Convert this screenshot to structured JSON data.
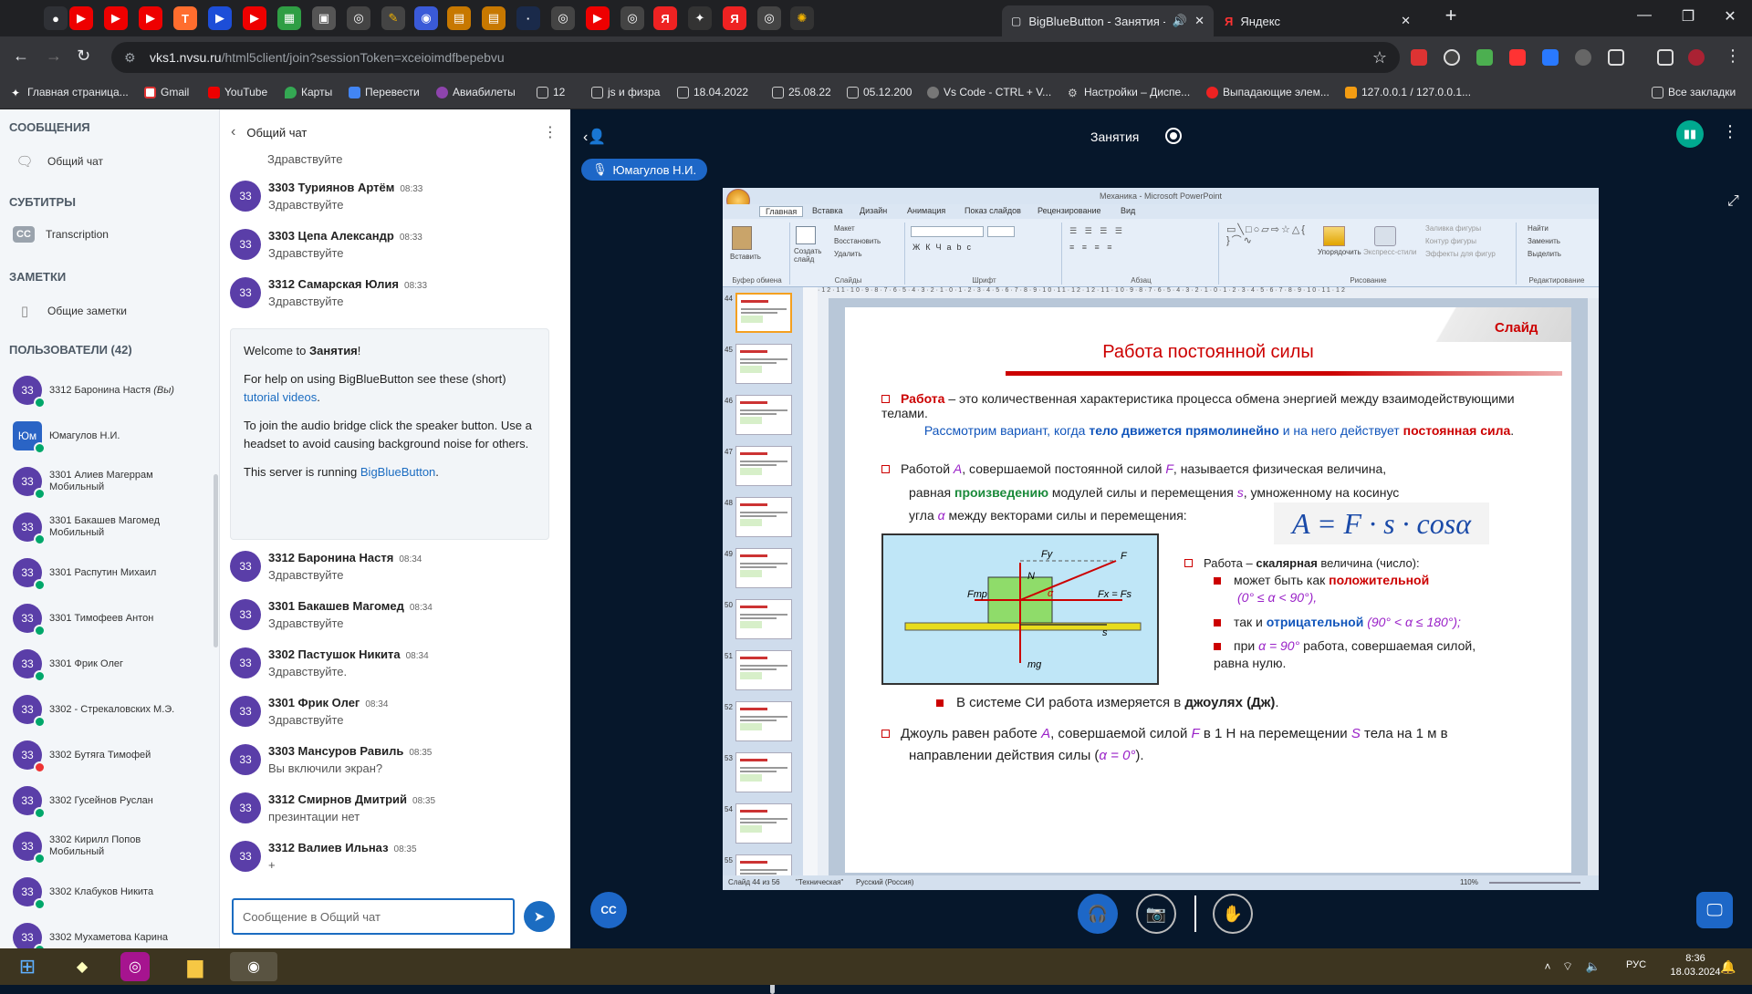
{
  "browser": {
    "active_tab_title": "BigBlueButton - Занятия - I",
    "second_tab_title": "Яндекс",
    "url_host": "vks1.nvsu.ru",
    "url_path": "/html5client/join?sessionToken=xceioimdfbepebvu",
    "bookmarks": [
      "Главная страница...",
      "Gmail",
      "YouTube",
      "Карты",
      "Перевести",
      "Авиабилеты",
      "12",
      "js и физра",
      "18.04.2022",
      "25.08.22",
      "05.12.200",
      "Vs Code - CTRL + V...",
      "Настройки – Диспе...",
      "Выпадающие элем...",
      "127.0.0.1 / 127.0.0.1..."
    ],
    "all_bookmarks": "Все закладки"
  },
  "sidebar": {
    "messages_header": "СООБЩЕНИЯ",
    "public_chat": "Общий чат",
    "captions_header": "СУБТИТРЫ",
    "transcription": "Transcription",
    "notes_header": "ЗАМЕТКИ",
    "shared_notes": "Общие заметки",
    "users_header": "ПОЛЬЗОВАТЕЛИ (42)",
    "users": [
      {
        "avatar": "33",
        "name": "3312 Баронина Настя",
        "suffix": "(Вы)"
      },
      {
        "avatar": "Юм",
        "name": "Юмагулов Н.И."
      },
      {
        "avatar": "33",
        "name": "3301 Алиев Магеррам",
        "sub": "Мобильный"
      },
      {
        "avatar": "33",
        "name": "3301 Бакашев Магомед",
        "sub": "Мобильный"
      },
      {
        "avatar": "33",
        "name": "3301 Распутин Михаил"
      },
      {
        "avatar": "33",
        "name": "3301 Тимофеев Антон"
      },
      {
        "avatar": "33",
        "name": "3301 Фрик Олег"
      },
      {
        "avatar": "33",
        "name": "3302 - Стрекаловских М.Э."
      },
      {
        "avatar": "33",
        "name": "3302 Бутяга Тимофей"
      },
      {
        "avatar": "33",
        "name": "3302 Гусейнов Руслан"
      },
      {
        "avatar": "33",
        "name": "3302 Кирилл Попов",
        "sub": "Мобильный"
      },
      {
        "avatar": "33",
        "name": "3302 Клабуков Никита"
      },
      {
        "avatar": "33",
        "name": "3302 Мухаметова Карина"
      }
    ]
  },
  "chat": {
    "title": "Общий чат",
    "cut_text": "Здравствуйте",
    "messages_top": [
      {
        "name": "3303 Туриянов Артём",
        "time": "08:33",
        "text": "Здравствуйте"
      },
      {
        "name": "3303 Цепа Александр",
        "time": "08:33",
        "text": "Здравствуйте"
      },
      {
        "name": "3312 Самарская Юлия",
        "time": "08:33",
        "text": "Здравствуйте"
      }
    ],
    "welcome": {
      "w1": "Welcome to ",
      "w1b": "Занятия",
      "w1e": "!",
      "w2": "For help on using BigBlueButton see these (short) ",
      "w2link": "tutorial videos",
      "w2e": ".",
      "w3": "To join the audio bridge click the speaker button. Use a headset to avoid causing background noise for others.",
      "w4": "This server is running ",
      "w4link": "BigBlueButton",
      "w4e": "."
    },
    "messages_bottom": [
      {
        "name": "3312 Баронина Настя",
        "time": "08:34",
        "text": "Здравствуйте"
      },
      {
        "name": "3301 Бакашев Магомед",
        "time": "08:34",
        "text": "Здравствуйте"
      },
      {
        "name": "3302 Пастушок Никита",
        "time": "08:34",
        "text": "Здравствуйте."
      },
      {
        "name": "3301 Фрик Олег",
        "time": "08:34",
        "text": "Здравствуйте"
      },
      {
        "name": "3303 Мансуров Равиль",
        "time": "08:35",
        "text": "Вы включили экран?"
      },
      {
        "name": "3312 Смирнов Дмитрий",
        "time": "08:35",
        "text": "презинтации нет"
      },
      {
        "name": "3312 Валиев Ильназ",
        "time": "08:35",
        "text": "+"
      }
    ],
    "input_placeholder": "Сообщение в Общий чат"
  },
  "main": {
    "meeting_title": "Занятия",
    "presenter": "Юмагулов Н.И."
  },
  "ppt": {
    "window_title": "Механика - Microsoft PowerPoint",
    "tabs": [
      "Главная",
      "Вставка",
      "Дизайн",
      "Анимация",
      "Показ слайдов",
      "Рецензирование",
      "Вид"
    ],
    "groups": {
      "clipboard": "Буфер обмена",
      "slides": "Слайды",
      "font": "Шрифт",
      "paragraph": "Абзац",
      "drawing": "Рисование",
      "editing": "Редактирование"
    },
    "btns": {
      "paste": "Вставить",
      "create": "Создать слайд",
      "layout": "Макет",
      "restore": "Восстановить",
      "delete": "Удалить",
      "arrange": "Упорядочить",
      "styles": "Экспресс-стили",
      "fill": "Заливка фигуры",
      "outline": "Контур фигуры",
      "effects": "Эффекты для фигур",
      "find": "Найти",
      "replace": "Заменить",
      "select": "Выделить"
    },
    "thumb_numbers": [
      "44",
      "45",
      "46",
      "47",
      "48",
      "49",
      "50",
      "51",
      "52",
      "53",
      "54",
      "55"
    ],
    "status": {
      "slide": "Слайд 44 из 56",
      "theme": "\"Техническая\"",
      "lang": "Русский (Россия)",
      "zoom": "110%"
    }
  },
  "slide": {
    "corner": "Слайд",
    "title": "Работа постоянной силы",
    "p1_b": "Работа",
    "p1": " – это количественная характеристика процесса обмена энергией между взаимодействующими телами.",
    "p2a": "Рассмотрим вариант, когда ",
    "p2b": "тело движется прямолинейно",
    "p2c": " и на него действует ",
    "p2d": "постоянная сила",
    "p2e": ".",
    "p3a": "Работой ",
    "p3v1": "A",
    "p3b": ", совершаемой постоянной силой ",
    "p3v2": "F",
    "p3c": ", называется физическая величина,",
    "p4a": "равная ",
    "p4b": "произведению",
    "p4c": " модулей силы и перемещения ",
    "p4v": "s",
    "p4d": ", умноженному на косинус",
    "p5a": "угла ",
    "p5v": "α",
    "p5b": " между векторами силы и перемещения:",
    "formula": "A = F · s · cosα",
    "r1a": "Работа – ",
    "r1b": "скалярная",
    "r1c": " величина (число):",
    "r2a": "может быть как ",
    "r2b": "положительной",
    "r2c": "(0° ≤ α < 90°),",
    "r3a": "так и ",
    "r3b": "отрицательной",
    "r3c": " (90° < α ≤ 180°);",
    "r4a": "при ",
    "r4b": "α = 90°",
    "r4c": " работа, совершаемая силой, равна нулю.",
    "si_a": "В системе СИ работа измеряется в ",
    "si_b": "джоулях (Дж)",
    "si_c": ".",
    "j1a": "Джоуль равен работе ",
    "j1v1": "A",
    "j1b": ", совершаемой силой ",
    "j1v2": "F",
    "j1c": " в 1 Н на перемещении ",
    "j1v3": "S",
    "j1d": " тела на 1 м в",
    "j2a": "направлении действия силы (",
    "j2v": "α = 0°",
    "j2b": ").",
    "diagram": {
      "fy": "Fy",
      "f": "F",
      "n": "N",
      "ftr": "Fтр",
      "fx": "Fx = Fs",
      "alpha": "α",
      "s": "s",
      "mg": "mg"
    }
  },
  "taskbar": {
    "lang": "РУС",
    "time": "8:36",
    "date": "18.03.2024"
  }
}
